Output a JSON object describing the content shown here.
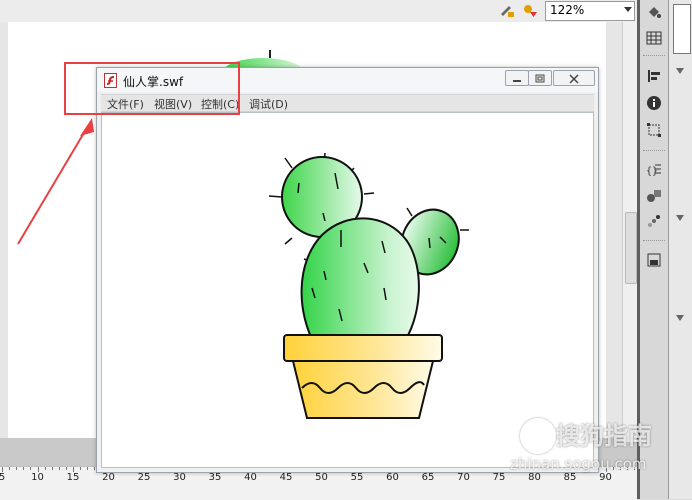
{
  "toolbar": {
    "zoom_value": "122%",
    "icons": [
      "edit-symbols-icon",
      "edit-scene-icon"
    ]
  },
  "player_window": {
    "title": "仙人掌.swf",
    "menu": [
      "文件(F)",
      "视图(V)",
      "控制(C)",
      "调试(D)"
    ],
    "file_icon": "swf-file-icon"
  },
  "ruler": {
    "labels": [
      "5",
      "10",
      "15",
      "20",
      "25",
      "30",
      "35",
      "40",
      "45",
      "50",
      "55",
      "60",
      "65",
      "70",
      "75",
      "80",
      "85",
      "90"
    ]
  },
  "watermark": {
    "text": "搜狗指南",
    "url": "zhinan.sogou.com"
  },
  "colors": {
    "highlight": "#e84043",
    "cactus_green": "#3ed54a",
    "pot_yellow": "#ffd23a"
  },
  "right_panel": {
    "icons": [
      "paint-bucket-icon",
      "grid-icon",
      "align-icon",
      "info-icon",
      "transform-icon",
      "code-snippet-icon",
      "components-icon",
      "motion-presets-icon",
      "library-icon"
    ]
  }
}
